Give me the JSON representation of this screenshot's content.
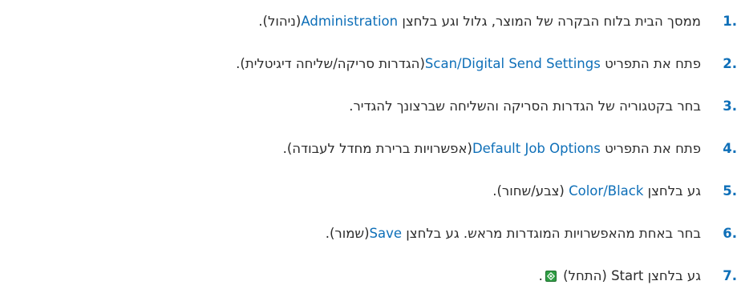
{
  "steps": [
    {
      "num": "1.",
      "before": "ממסך הבית בלוח הבקרה של המוצר, גלול וגע בלחצן ",
      "ui": "Administration",
      "after": "(ניהול)."
    },
    {
      "num": "2.",
      "before": "פתח את התפריט ",
      "ui": "Scan/Digital Send Settings",
      "after": "(הגדרות סריקה/שליחה דיגיטלית)."
    },
    {
      "num": "3.",
      "before": "בחר בקטגוריה של הגדרות הסריקה והשליחה שברצונך להגדיר.",
      "ui": "",
      "after": ""
    },
    {
      "num": "4.",
      "before": "פתח את התפריט ",
      "ui": "Default Job Options",
      "after": "(אפשרויות ברירת מחדל לעבודה)."
    },
    {
      "num": "5.",
      "before": "גע בלחצן ",
      "ui": "Color/Black",
      "after": " (צבע/שחור)."
    },
    {
      "num": "6.",
      "before": "בחר באחת מהאפשרויות המוגדרות מראש. גע בלחצן ",
      "ui": "Save",
      "after": "(שמור)."
    },
    {
      "num": "7.",
      "before": "גע בלחצן ",
      "ui": "Start",
      "after": " (התחל) ",
      "icon": "start-button-icon",
      "end": "."
    }
  ],
  "colors": {
    "accent": "#0e6fb8",
    "text": "#2b2b2b",
    "start_icon": "#2f9e44"
  }
}
